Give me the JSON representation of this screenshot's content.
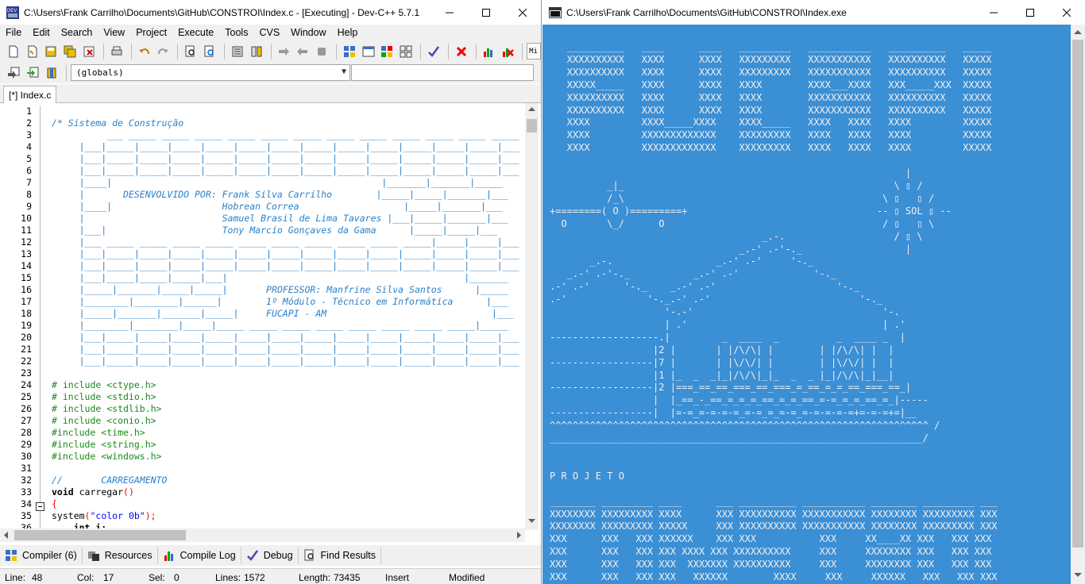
{
  "devcpp": {
    "title": "C:\\Users\\Frank Carrilho\\Documents\\GitHub\\CONSTROI\\Index.c - [Executing] - Dev-C++ 5.7.1",
    "menu": [
      "File",
      "Edit",
      "Search",
      "View",
      "Project",
      "Execute",
      "Tools",
      "CVS",
      "Window",
      "Help"
    ],
    "globals_combo": "(globals)",
    "toolbar_overflow_label": "Mi",
    "tab": "[*] Index.c",
    "line_numbers": [
      "1",
      "2",
      "3",
      "4",
      "5",
      "6",
      "7",
      "8",
      "9",
      "10",
      "11",
      "12",
      "13",
      "14",
      "15",
      "16",
      "17",
      "18",
      "19",
      "20",
      "21",
      "22",
      "23",
      "24",
      "25",
      "26",
      "27",
      "28",
      "29",
      "30",
      "31",
      "32",
      "33",
      "34",
      "35",
      "36"
    ],
    "code_lines": [
      {
        "t": "",
        "c": ""
      },
      {
        "t": "/* Sistema de Construção",
        "c": "cmt"
      },
      {
        "t": "          ___ _____ _____ _____ _____ _____ _____ _____ _____ _____ _____ _____ _____",
        "c": "cmt"
      },
      {
        "t": "     |___|_____|_____|_____|_____|_____|_____|_____|_____|_____|_____|_____|_____|___",
        "c": "cmt"
      },
      {
        "t": "     |___|_____|_____|_____|_____|_____|_____|_____|_____|_____|_____|_____|_____|___",
        "c": "cmt"
      },
      {
        "t": "     |___|_____|_____|_____|_____|_____|_____|_____|_____|_____|_____|_____|_____|___",
        "c": "cmt"
      },
      {
        "t": "     |____|                                                 |_______|_______|_____",
        "c": "cmt"
      },
      {
        "t": "     |       DESENVOLVIDO POR: Frank Silva Carrilho        |_____|_____|_______|___",
        "c": "cmt"
      },
      {
        "t": "     |____|                    Hobrean Correa                   |_____|_______|___",
        "c": "cmt"
      },
      {
        "t": "     |                         Samuel Brasil de Lima Tavares |___|_____|_______|___",
        "c": "cmt"
      },
      {
        "t": "     |___|                     Tony Marcio Gonçaves da Gama      |_____|_____|___",
        "c": "cmt"
      },
      {
        "t": "     |___ _____ _____ _____ _____ _____ _____ _____ _____ _____ _____|_____|_____|___",
        "c": "cmt"
      },
      {
        "t": "     |___|_____|_____|_____|_____|_____|_____|_____|_____|_____|_____|_____|_____|___",
        "c": "cmt"
      },
      {
        "t": "     |___|_____|_____|_____|_____|_____|_____|_____|_____|_____|_____|_____|_____|___",
        "c": "cmt"
      },
      {
        "t": "     |___|_____|_____|_____|___|                                           |_______",
        "c": "cmt"
      },
      {
        "t": "     |_____|_______|_____|_____|       PROFESSOR: Manfrine Silva Santos      |_____",
        "c": "cmt"
      },
      {
        "t": "     |________|________|______|        1º Módulo - Técnico em Informática      |___",
        "c": "cmt"
      },
      {
        "t": "     |_____|_______|_______|_____|     FUCAPI - AM                              |___",
        "c": "cmt"
      },
      {
        "t": "     |________|________|_____|_____ _____ _____ _____ _____ _____ _____ _____|_____",
        "c": "cmt"
      },
      {
        "t": "     |___|_____|_____|_____|_____|_____|_____|_____|_____|_____|_____|_____|_____|___",
        "c": "cmt"
      },
      {
        "t": "     |___|_____|_____|_____|_____|_____|_____|_____|_____|_____|_____|_____|_____|___",
        "c": "cmt"
      },
      {
        "t": "     |___|_____|_____|_____|_____|_____|_____|_____|_____|_____|_____|_____|_____|___",
        "c": "cmt"
      },
      {
        "t": "",
        "c": ""
      },
      {
        "t": "# include <ctype.h>",
        "c": "pre"
      },
      {
        "t": "# include <stdio.h>",
        "c": "pre"
      },
      {
        "t": "# include <stdlib.h>",
        "c": "pre"
      },
      {
        "t": "# include <conio.h>",
        "c": "pre"
      },
      {
        "t": "#include <time.h>",
        "c": "pre"
      },
      {
        "t": "#include <string.h>",
        "c": "pre"
      },
      {
        "t": "#include <windows.h>",
        "c": "pre"
      },
      {
        "t": "",
        "c": ""
      },
      {
        "t": "//       CARREGAMENTO",
        "c": "cmt"
      },
      {
        "t": "void carregar()",
        "c": "fn"
      },
      {
        "t": "{",
        "c": "sym"
      },
      {
        "t": "system(\"color 0b\");",
        "c": "sys"
      },
      {
        "t": "    int i;",
        "c": "kw"
      }
    ],
    "bottom_tabs": [
      "Compiler (6)",
      "Resources",
      "Compile Log",
      "Debug",
      "Find Results"
    ],
    "status": {
      "line_label": "Line:",
      "line": "48",
      "col_label": "Col:",
      "col": "17",
      "sel_label": "Sel:",
      "sel": "0",
      "lines_label": "Lines:",
      "lines": "1572",
      "length_label": "Length:",
      "length": "73435",
      "mode": "Insert",
      "state": "Modified"
    }
  },
  "console": {
    "title": "C:\\Users\\Frank Carrilho\\Documents\\GitHub\\CONSTROI\\Index.exe",
    "output": "   __________   ____      ____   _________   ___________   __________   _____\n   XXXXXXXXXX   XXXX      XXXX   XXXXXXXXX   XXXXXXXXXXX   XXXXXXXXXX   XXXXX\n   XXXXXXXXXX   XXXX      XXXX   XXXXXXXXX   XXXXXXXXXXX   XXXXXXXXXX   XXXXX\n   XXXXX_____   XXXX      XXXX   XXXX        XXXX___XXXX   XXX_____XXX  XXXXX\n   XXXXXXXXXX   XXXX      XXXX   XXXX        XXXXXXXXXXX   XXXXXXXXXX   XXXXX\n   XXXXXXXXXX   XXXX      XXXX   XXXX        XXXXXXXXXXX   XXXXXXXXXX   XXXXX\n   XXXX         XXXX_____XXXX    XXXX_____   XXXX   XXXX   XXXX         XXXXX\n   XXXX         XXXXXXXXXXXXX    XXXXXXXXX   XXXX   XXXX   XXXX         XXXXX\n   XXXX         XXXXXXXXXXXXX    XXXXXXXXX   XXXX   XXXX   XXXX         XXXXX\n\n                                                              |\n          _|_                                               \\ ▯ /\n          /_\\                                             \\ ▯   ▯ /\n+========( O )=========+                                 -- ▯ SOL ▯ --\n  O       \\_/      O                                      / ▯   ▯ \\\n                                     _.-.                   / ▯ \\\n                                 _.-' .-'-._                  |\n       _.-.                  _.-' .-'     '-._\n   _.-' .-'-._           _.-' .-'             '-._\n.-' .-'      '-._    _.-' .-'                     '-._\n.-'              '-._.-' .-'                          '-._\n                    '-.-'                                 '-.\n                    | .'                                  | .'\n-------------------.|         _  ____  _          _  ____ _  |\n                  |2 |       | |/\\/\\| |        | |/\\/\\| |  |\n------------------|7 |       | |\\/\\/| |        | |\\/\\/| |  |\n                  |1 |_  _  _|_|/\\/\\|_|_  _  _ |_|/\\/\\|_|__|\n------------------|2 |===_==_==_===_==_===_=_==_=_=_==_===_==_|\n                  |  |_==_-_==_=_=_=_==_=_=_==_=-=_=_=_==_=_|-----\n------------------|  |=-=_=-=-=-=_=-=_=_=-=_=-=-=-=-=+=-=-=+=|__\n^^^^^^^^^^^^^^^^^^^^^^^^^^^^^^^^^^^^^^^^^^^^^^^^^^^^^^^^^^^^^^^^^^ /\n_________________________________________________________________/\n\n\nP R O J E T O\n\n________ _________ ____      ___ __________ ___________ ________ _________ ___\nXXXXXXXX XXXXXXXXX XXXX      XXX XXXXXXXXXX XXXXXXXXXXX XXXXXXXX XXXXXXXXX XXX\nXXXXXXXX XXXXXXXXX XXXXX     XXX XXXXXXXXXX XXXXXXXXXXX XXXXXXXX XXXXXXXXX XXX\nXXX      XXX   XXX XXXXXX    XXX XXX           XXX     XX____XX XXX   XXX XXX\nXXX      XXX   XXX XXX XXXX XXX XXXXXXXXXX     XXX     XXXXXXXX XXX   XXX XXX\nXXX      XXX   XXX XXX  XXXXXXX XXXXXXXXXX     XXX     XXXXXXXX XXX   XXX XXX\nXXX      XXX   XXX XXX   XXXXXX        XXXX     XXX     XXXXXX   XXX   XXX XXX\nXXXXXXXX XXXXXXXXX XXX    XXXXX XXXXXXXXXX     XXX     XXX XXX  XXXXXXXXX XXX\nXXXXXXXX XXXXXXXXX XXX     XXXX XXXXXXXXXX     XXX     XXX  XXX XXXXXXXXX XXX"
  }
}
